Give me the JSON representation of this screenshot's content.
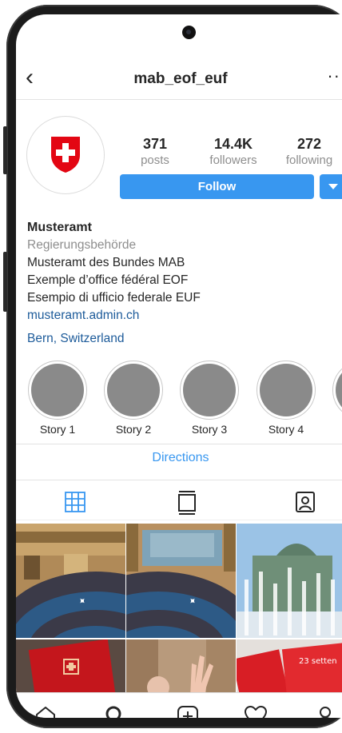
{
  "header": {
    "username": "mab_eof_euf",
    "back_icon": "chevron-left-icon",
    "more_icon": "more-dots-icon"
  },
  "profile": {
    "avatar_icon": "swiss-shield-icon",
    "stats": [
      {
        "value": "371",
        "label": "posts"
      },
      {
        "value": "14.4K",
        "label": "followers"
      },
      {
        "value": "272",
        "label": "following"
      }
    ],
    "follow_label": "Follow",
    "name": "Musteramt",
    "category": "Regierungsbehörde",
    "bio_lines": [
      "Musteramt des Bundes MAB",
      "Exemple d’office fédéral EOF",
      "Esempio di ufficio federale EUF"
    ],
    "website": "musteramt.admin.ch",
    "location": "Bern, Switzerland"
  },
  "highlights": [
    {
      "label": "Story 1"
    },
    {
      "label": "Story 2"
    },
    {
      "label": "Story 3"
    },
    {
      "label": "Story 4"
    }
  ],
  "directions_label": "Directions",
  "tabs": [
    "grid-icon",
    "feed-icon",
    "tagged-icon"
  ],
  "grid_posts": [
    {
      "name": "parliament-chamber-left"
    },
    {
      "name": "parliament-chamber-right"
    },
    {
      "name": "fountain-federal-palace"
    },
    {
      "name": "red-folder-swiss"
    },
    {
      "name": "hand-raised"
    },
    {
      "name": "red-cards",
      "text": "23 setten"
    }
  ],
  "bottom_nav": [
    "home-icon",
    "search-icon",
    "add-post-icon",
    "heart-icon",
    "profile-icon"
  ],
  "colors": {
    "accent": "#3897f0",
    "link": "#1d5b9a",
    "swiss_red": "#e30613",
    "muted": "#8e8e8e"
  }
}
